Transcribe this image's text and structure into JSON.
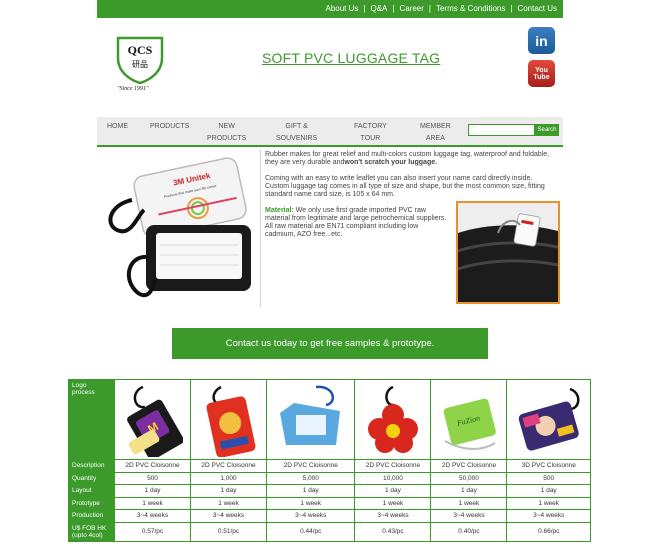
{
  "top_nav": {
    "items": [
      "About Us",
      "Q&A",
      "Career",
      "Terms & Conditions",
      "Contact Us"
    ],
    "separator": "|"
  },
  "logo": {
    "text": "QCS",
    "chinese": "研品",
    "since": "\"Since 1991\""
  },
  "page_title": "SOFT PVC LUGGAGE TAG",
  "social": {
    "linkedin_icon": "in",
    "youtube_top": "You",
    "youtube_bottom": "Tube"
  },
  "main_nav": {
    "home": "HOME",
    "products": "PRODUCTS",
    "new_products_1": "NEW",
    "new_products_2": "PRODUCTS",
    "gift_1": "GIFT &",
    "gift_2": "SOUVENIRS",
    "factory_1": "FACTORY",
    "factory_2": "TOUR",
    "member_1": "MEMBER",
    "member_2": "AREA",
    "search_button": "Search",
    "search_placeholder": ""
  },
  "description": {
    "p1_start": "Rubber makes for great relief and multi-colors custom luggage tag, waterproof and foldable, they are very durable and",
    "p1_bold": "won't scratch your luggage.",
    "p2": "Coming with an easy to write leaflet you can also insert your name card directly inside. Custom luggage tag comes in all type of size and shape, but the most common size, fitting standard name card size, is 105 x 64 mm.",
    "p3_label": "Material:",
    "p3_text": "We only use first grade imported PVC raw material from legitimate and large petrochemical suppliers. All raw material are EN71 compliant including low cadmium, AZO free...etc."
  },
  "product_image": {
    "brand": "3M Unitek",
    "tagline": "Products that make your life easier"
  },
  "contact_banner": "Contact us today to get free samples & prototype.",
  "colors": {
    "brand_green": "#3c9a2b",
    "photo_border": "#e8912b"
  },
  "spec_table": {
    "row_headers": {
      "logo_process_1": "Logo",
      "logo_process_2": "process",
      "description": "Description",
      "quantity": "Quantity",
      "layout": "Layout",
      "prototype": "Prototype",
      "production": "Production",
      "price_1": "U$ FOB HK",
      "price_2": "(upto 4col)"
    },
    "columns": [
      {
        "description": "2D PVC Cloisonne",
        "quantity": "500",
        "layout": "1 day",
        "prototype": "1 week",
        "production": "3~4 weeks",
        "price": "0.57/pc"
      },
      {
        "description": "2D PVC Cloisonne",
        "quantity": "1,000",
        "layout": "1 day",
        "prototype": "1 week",
        "production": "3~4 weeks",
        "price": "0.51/pc"
      },
      {
        "description": "2D PVC Cloisonne",
        "quantity": "5,000",
        "layout": "1 day",
        "prototype": "1 week",
        "production": "3~4 weeks",
        "price": "0.44/pc"
      },
      {
        "description": "2D PVC Cloisonne",
        "quantity": "10,000",
        "layout": "1 day",
        "prototype": "1 week",
        "production": "3~4 weeks",
        "price": "0.43/pc"
      },
      {
        "description": "2D PVC Cloisonne",
        "quantity": "50,000",
        "layout": "1 day",
        "prototype": "1 week",
        "production": "3~4 weeks",
        "price": "0.40/pc"
      },
      {
        "description": "3D PVC Cloisonne",
        "quantity": "500",
        "layout": "1 day",
        "prototype": "1 week",
        "production": "3~4 weeks",
        "price": "0.66/pc"
      }
    ]
  }
}
